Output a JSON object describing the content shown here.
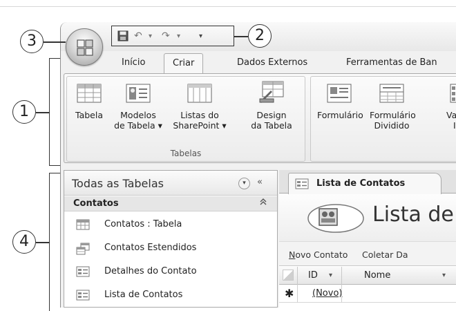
{
  "callouts": {
    "c1": "1",
    "c2": "2",
    "c3": "3",
    "c4": "4"
  },
  "quick_access": {
    "save_icon": "save-icon",
    "undo": "↶",
    "redo": "↷",
    "more": "▾"
  },
  "tabs": [
    "Início",
    "Criar",
    "Dados Externos",
    "Ferramentas de Ban"
  ],
  "active_tab": "Criar",
  "ribbon": {
    "group_tabelas": {
      "label": "Tabelas",
      "buttons": [
        {
          "line1": "Tabela",
          "line2": ""
        },
        {
          "line1": "Modelos",
          "line2": "de Tabela ▾"
        },
        {
          "line1": "Listas do",
          "line2": "SharePoint ▾"
        },
        {
          "line1": "Design",
          "line2": "da Tabela"
        }
      ]
    },
    "group_forms": {
      "buttons": [
        {
          "line1": "Formulário",
          "line2": ""
        },
        {
          "line1": "Formulário",
          "line2": "Dividido"
        },
        {
          "line1": "Va",
          "line2": "It"
        }
      ]
    }
  },
  "nav_pane": {
    "title": "Todas as Tabelas",
    "dropdown": "▾",
    "collapse": "«",
    "group": {
      "name": "Contatos",
      "toggle": "∩"
    },
    "items": [
      {
        "label": "Contatos : Tabela",
        "icon": "table-icon"
      },
      {
        "label": "Contatos Estendidos",
        "icon": "query-icon"
      },
      {
        "label": "Detalhes do Contato",
        "icon": "form-icon"
      },
      {
        "label": "Lista de Contatos",
        "icon": "form-icon"
      }
    ]
  },
  "document": {
    "tab_label": "Lista de Contatos",
    "header_title": "Lista de",
    "commands": {
      "novo_contato_u": "N",
      "novo_contato_rest": "ovo Contato",
      "coletar": "Coletar Da"
    },
    "grid": {
      "columns": [
        "ID",
        "Nome",
        "▾"
      ],
      "sort_arrow": "▾",
      "new_row_marker": "✱",
      "new_row_value": "(Novo)"
    }
  }
}
